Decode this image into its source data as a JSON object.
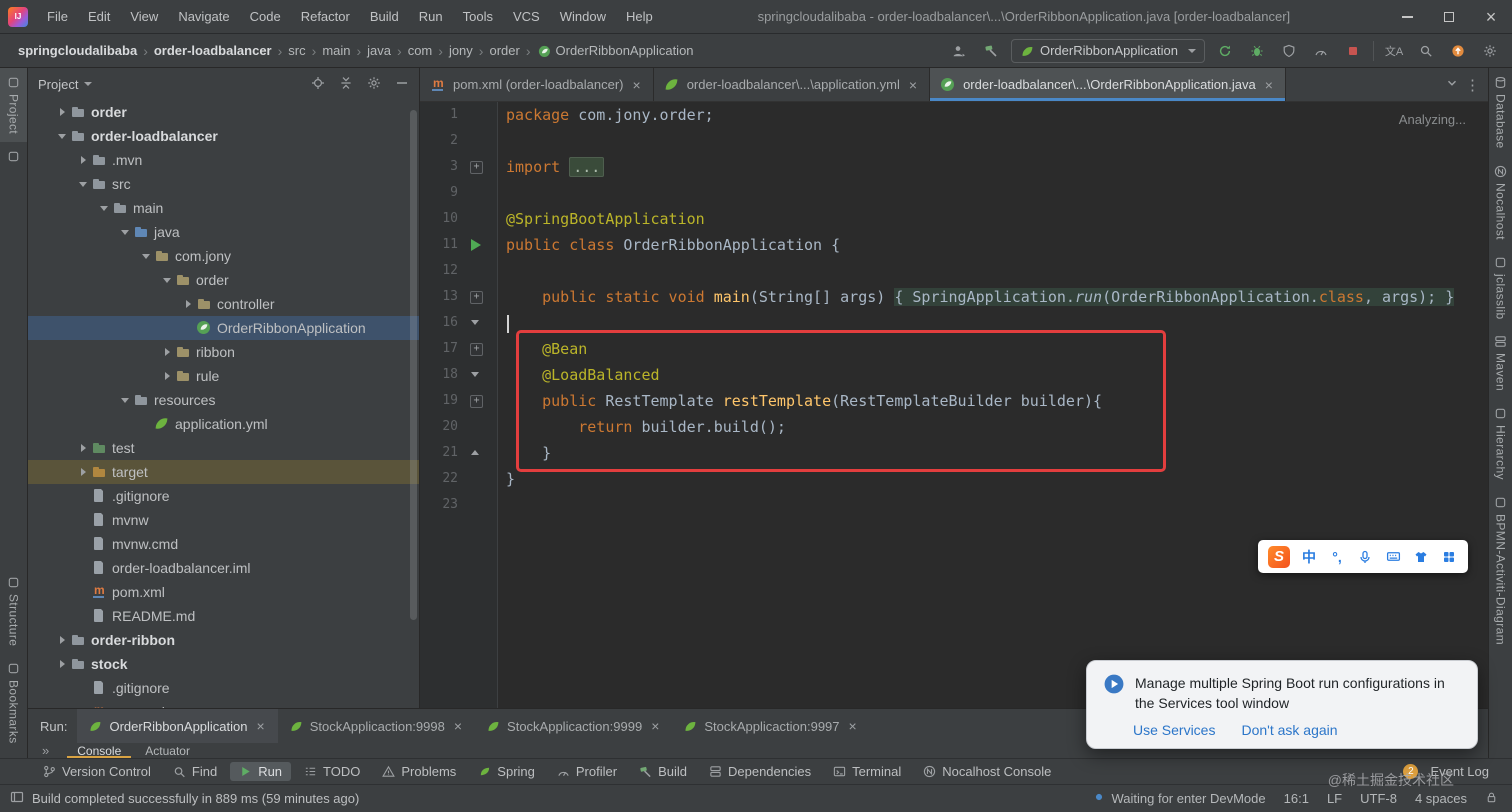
{
  "colors": {
    "editor_bg": "#2b2b2b",
    "panel_bg": "#3c3f41",
    "accent_blue": "#4a88c7",
    "spring_green": "#6db33f",
    "keyword_orange": "#cc7832",
    "annotation_yellow": "#bbb529",
    "method_yellow": "#ffc66b",
    "annotation_box_red": "#e33e3e",
    "run_green": "#4faa54"
  },
  "titlebar": {
    "menus": [
      "File",
      "Edit",
      "View",
      "Navigate",
      "Code",
      "Refactor",
      "Build",
      "Run",
      "Tools",
      "VCS",
      "Window",
      "Help"
    ],
    "title": "springcloudalibaba - order-loadbalancer\\...\\OrderRibbonApplication.java [order-loadbalancer]"
  },
  "navbar": {
    "separator": "›",
    "breadcrumbs": [
      {
        "label": "springcloudalibaba",
        "bold": true
      },
      {
        "label": "order-loadbalancer",
        "bold": true
      },
      {
        "label": "src"
      },
      {
        "label": "main"
      },
      {
        "label": "java"
      },
      {
        "label": "com"
      },
      {
        "label": "jony"
      },
      {
        "label": "order"
      },
      {
        "label": "OrderRibbonApplication",
        "icon": "spring-class"
      }
    ],
    "run_config": "OrderRibbonApplication"
  },
  "left_stripe": {
    "project": "Project",
    "structure": "Structure",
    "bookmarks": "Bookmarks"
  },
  "right_stripe": [
    "Database",
    "Nocalhost",
    "jclasslib",
    "Maven",
    "Hierarchy",
    "BPMN-Activiti-Diagram"
  ],
  "project_panel": {
    "title": "Project",
    "tree": [
      {
        "label": "order",
        "level": 0,
        "chev": "r",
        "icon": "folder",
        "bold": true
      },
      {
        "label": "order-loadbalancer",
        "level": 0,
        "chev": "d",
        "icon": "folder",
        "bold": true
      },
      {
        "label": ".mvn",
        "level": 1,
        "chev": "r",
        "icon": "folder"
      },
      {
        "label": "src",
        "level": 1,
        "chev": "d",
        "icon": "folder"
      },
      {
        "label": "main",
        "level": 2,
        "chev": "d",
        "icon": "folder"
      },
      {
        "label": "java",
        "level": 3,
        "chev": "d",
        "icon": "folder-src"
      },
      {
        "label": "com.jony",
        "level": 4,
        "chev": "d",
        "icon": "package"
      },
      {
        "label": "order",
        "level": 5,
        "chev": "d",
        "icon": "package"
      },
      {
        "label": "controller",
        "level": 6,
        "chev": "r",
        "icon": "package"
      },
      {
        "label": "OrderRibbonApplication",
        "level": 6,
        "icon": "spring-class",
        "selected": true
      },
      {
        "label": "ribbon",
        "level": 5,
        "chev": "r",
        "icon": "package"
      },
      {
        "label": "rule",
        "level": 5,
        "chev": "r",
        "icon": "package"
      },
      {
        "label": "resources",
        "level": 3,
        "chev": "d",
        "icon": "folder-res"
      },
      {
        "label": "application.yml",
        "level": 4,
        "icon": "spring-leaf"
      },
      {
        "label": "test",
        "level": 1,
        "chev": "r",
        "icon": "folder-test"
      },
      {
        "label": "target",
        "level": 1,
        "chev": "r",
        "icon": "folder-target",
        "highlight": true
      },
      {
        "label": ".gitignore",
        "level": 1,
        "icon": "file"
      },
      {
        "label": "mvnw",
        "level": 1,
        "icon": "file"
      },
      {
        "label": "mvnw.cmd",
        "level": 1,
        "icon": "file"
      },
      {
        "label": "order-loadbalancer.iml",
        "level": 1,
        "icon": "file"
      },
      {
        "label": "pom.xml",
        "level": 1,
        "icon": "maven"
      },
      {
        "label": "README.md",
        "level": 1,
        "icon": "file-md"
      },
      {
        "label": "order-ribbon",
        "level": 0,
        "chev": "r",
        "icon": "folder",
        "bold": true
      },
      {
        "label": "stock",
        "level": 0,
        "chev": "r",
        "icon": "folder",
        "bold": true
      },
      {
        "label": ".gitignore",
        "level": 1,
        "icon": "file"
      },
      {
        "label": "pom.xml",
        "level": 1,
        "icon": "maven"
      }
    ]
  },
  "editor": {
    "tabs": [
      {
        "label": "pom.xml (order-loadbalancer)",
        "icon": "maven"
      },
      {
        "label": "order-loadbalancer\\...\\application.yml",
        "icon": "spring-leaf"
      },
      {
        "label": "order-loadbalancer\\...\\OrderRibbonApplication.java",
        "icon": "spring-class",
        "active": true
      }
    ],
    "status_hint": "Analyzing...",
    "lines": [
      {
        "num": "1",
        "tokens": [
          {
            "t": "package ",
            "c": "kw"
          },
          {
            "t": "com.jony.order;",
            "c": "pl"
          }
        ]
      },
      {
        "num": "2",
        "tokens": []
      },
      {
        "num": "3",
        "g": "plus",
        "tokens": [
          {
            "t": "import ",
            "c": "kw"
          },
          {
            "t": "...",
            "c": "fold"
          }
        ]
      },
      {
        "num": "9",
        "tokens": []
      },
      {
        "num": "10",
        "tokens": [
          {
            "t": "@SpringBootApplication",
            "c": "ann"
          }
        ]
      },
      {
        "num": "11",
        "g": "run",
        "tokens": [
          {
            "t": "public class ",
            "c": "kw"
          },
          {
            "t": "OrderRibbonApplication {",
            "c": "pl"
          }
        ]
      },
      {
        "num": "12",
        "tokens": []
      },
      {
        "num": "13",
        "g": "plus",
        "tokens": [
          {
            "t": "    ",
            "c": "pl"
          },
          {
            "t": "public static void ",
            "c": "kw"
          },
          {
            "t": "main",
            "c": "m"
          },
          {
            "t": "(String[] args) ",
            "c": "pl"
          },
          {
            "t": "{ SpringApplication.",
            "c": "fbg"
          },
          {
            "t": "run",
            "c": "fbg-it"
          },
          {
            "t": "(OrderRibbonApplication.",
            "c": "fbg"
          },
          {
            "t": "class",
            "c": "fbg-kw"
          },
          {
            "t": ", args); }",
            "c": "fbg"
          }
        ]
      },
      {
        "num": "16",
        "g": "down",
        "caret": true,
        "tokens": []
      },
      {
        "num": "17",
        "g": "plus",
        "tokens": [
          {
            "t": "    ",
            "c": "pl"
          },
          {
            "t": "@Bean",
            "c": "ann"
          }
        ]
      },
      {
        "num": "18",
        "g": "down",
        "tokens": [
          {
            "t": "    ",
            "c": "pl"
          },
          {
            "t": "@LoadBalanced",
            "c": "ann"
          }
        ]
      },
      {
        "num": "19",
        "g": "plus",
        "tokens": [
          {
            "t": "    ",
            "c": "pl"
          },
          {
            "t": "public ",
            "c": "kw"
          },
          {
            "t": "RestTemplate ",
            "c": "pl"
          },
          {
            "t": "restTemplate",
            "c": "m"
          },
          {
            "t": "(RestTemplateBuilder builder){",
            "c": "pl"
          }
        ]
      },
      {
        "num": "20",
        "tokens": [
          {
            "t": "        ",
            "c": "pl"
          },
          {
            "t": "return ",
            "c": "kw"
          },
          {
            "t": "builder.build();",
            "c": "pl"
          }
        ]
      },
      {
        "num": "21",
        "g": "up",
        "tokens": [
          {
            "t": "    }",
            "c": "pl"
          }
        ]
      },
      {
        "num": "22",
        "tokens": [
          {
            "t": "}",
            "c": "pl"
          }
        ]
      },
      {
        "num": "23",
        "tokens": []
      }
    ]
  },
  "run_panel": {
    "label": "Run:",
    "tabs": [
      {
        "label": "OrderRibbonApplication",
        "active": true
      },
      {
        "label": "StockApplicaction:9998"
      },
      {
        "label": "StockApplicaction:9999"
      },
      {
        "label": "StockApplicaction:9997"
      }
    ],
    "sub_tabs": [
      {
        "label": "Console",
        "active": true
      },
      {
        "label": "Actuator"
      }
    ]
  },
  "tool_bar": {
    "items": [
      {
        "label": "Version Control",
        "icon": "vcs"
      },
      {
        "label": "Find",
        "icon": "find"
      },
      {
        "label": "Run",
        "icon": "run",
        "active": true
      },
      {
        "label": "TODO",
        "icon": "todo"
      },
      {
        "label": "Problems",
        "icon": "problems"
      },
      {
        "label": "Spring",
        "icon": "spring"
      },
      {
        "label": "Profiler",
        "icon": "profiler"
      },
      {
        "label": "Build",
        "icon": "build"
      },
      {
        "label": "Dependencies",
        "icon": "deps"
      },
      {
        "label": "Terminal",
        "icon": "terminal"
      },
      {
        "label": "Nocalhost Console",
        "icon": "nocalhost"
      }
    ],
    "event_log": {
      "label": "Event Log",
      "badge": "2"
    }
  },
  "status_bar": {
    "message": "Build completed successfully in 889 ms (59 minutes ago)",
    "devmode": "Waiting for enter DevMode",
    "caret_pos": "16:1",
    "line_sep": "LF",
    "encoding": "UTF-8",
    "indent": "4 spaces",
    "watermark": "@稀土掘金技术社区"
  },
  "notification": {
    "message": "Manage multiple Spring Boot run configurations in the Services tool window",
    "links": [
      "Use Services",
      "Don't ask again"
    ]
  },
  "sogou": {
    "logo": "S",
    "chinese": "中",
    "punct": "°,"
  }
}
